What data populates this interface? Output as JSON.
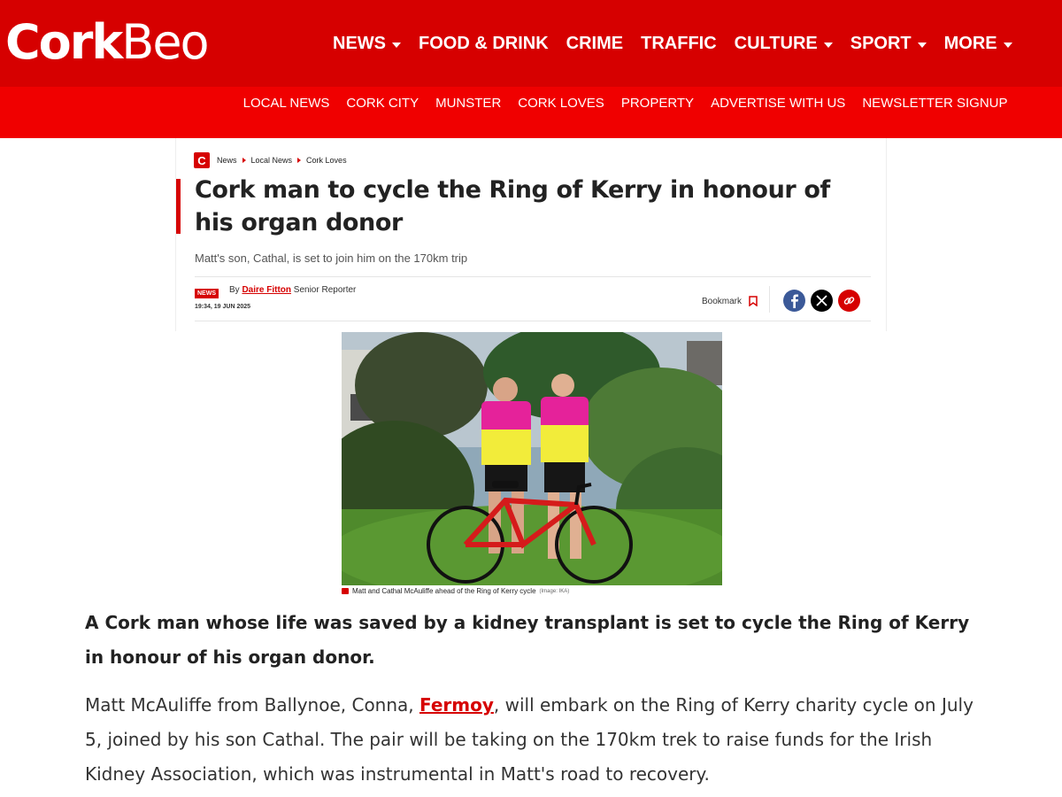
{
  "header": {
    "logo_bold": "Cork",
    "logo_light": "Beo",
    "main_nav": [
      {
        "label": "NEWS",
        "has_dropdown": true
      },
      {
        "label": "FOOD & DRINK",
        "has_dropdown": false
      },
      {
        "label": "CRIME",
        "has_dropdown": false
      },
      {
        "label": "TRAFFIC",
        "has_dropdown": false
      },
      {
        "label": "CULTURE",
        "has_dropdown": true
      },
      {
        "label": "SPORT",
        "has_dropdown": true
      },
      {
        "label": "MORE",
        "has_dropdown": true
      }
    ],
    "sub_nav": [
      "LOCAL NEWS",
      "CORK CITY",
      "MUNSTER",
      "CORK LOVES",
      "PROPERTY",
      "ADVERTISE WITH US",
      "NEWSLETTER SIGNUP"
    ]
  },
  "breadcrumb": {
    "logo_letter": "C",
    "items": [
      "News",
      "Local News",
      "Cork Loves"
    ]
  },
  "article": {
    "headline": "Cork man to cycle the Ring of Kerry in honour of his organ donor",
    "standfirst": "Matt's son, Cathal, is set to join him on the 170km trip",
    "badge": "NEWS",
    "byline_prefix": "By",
    "author": "Daire Fitton",
    "author_role": "Senior Reporter",
    "timestamp": "19:34, 19 JUN 2025",
    "bookmark_label": "Bookmark",
    "caption": "Matt and Cathal McAuliffe ahead of the Ring of Kerry cycle",
    "caption_credit": "(Image: IKA)",
    "lead": "A Cork man whose life was saved by a kidney transplant is set to cycle the Ring of Kerry in honour of his organ donor.",
    "para_before_link": "Matt McAuliffe from Ballynoe, Conna, ",
    "para_link": "Fermoy",
    "para_after_link": ", will embark on the Ring of Kerry charity cycle on July 5, joined by his son Cathal. The pair will be taking on the 170km trek to raise funds for the Irish Kidney Association, which was instrumental in Matt's road to recovery."
  },
  "colors": {
    "brand_red": "#d60000",
    "subnav_red": "#f00000",
    "facebook": "#3b5998"
  },
  "icons": [
    "caret-down-icon",
    "chevron-right-icon",
    "bookmark-icon",
    "facebook-icon",
    "x-icon",
    "link-icon",
    "camera-icon"
  ]
}
